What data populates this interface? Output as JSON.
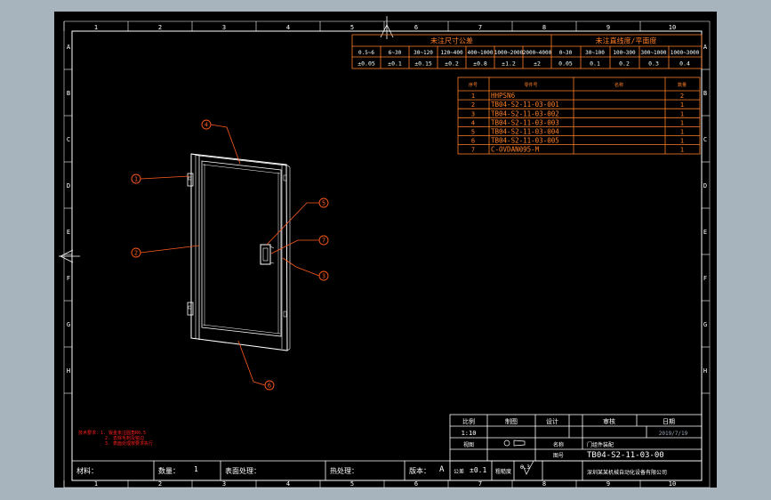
{
  "colors": {
    "background_outer": "#a7b3bd",
    "drawing_area": "#000000",
    "frame": "#ffffff",
    "table_lines": "#ff7f27",
    "leader": "#ff5a1f",
    "notes": "#ff2020"
  },
  "border_numbers_top": [
    "1",
    "2",
    "3",
    "4",
    "5",
    "6",
    "7",
    "8",
    "9",
    "10"
  ],
  "border_numbers_bottom": [
    "1",
    "2",
    "3",
    "4",
    "5",
    "6",
    "7",
    "8",
    "9",
    "10"
  ],
  "border_letters": [
    "A",
    "B",
    "C",
    "D",
    "E",
    "F",
    "G",
    "H"
  ],
  "tolerance_table": {
    "linear_title": "未注尺寸公差",
    "flatness_title": "未注直线度/平面度",
    "linear_ranges": [
      "0.5~6",
      "6~30",
      "30~120",
      "120~400",
      "400~1000",
      "1000~2000",
      "2000~4000"
    ],
    "linear_values": [
      "±0.05",
      "±0.1",
      "±0.15",
      "±0.2",
      "±0.8",
      "±1.2",
      "±2"
    ],
    "flat_ranges": [
      "0~30",
      "30~100",
      "100~300",
      "300~1000",
      "1000~3000"
    ],
    "flat_values": [
      "0.05",
      "0.1",
      "0.2",
      "0.3",
      "0.4"
    ]
  },
  "bom": {
    "headers": [
      "序号",
      "零件号",
      "名称",
      "数量"
    ],
    "rows": [
      [
        "1",
        "HHPSN6",
        "",
        "2"
      ],
      [
        "2",
        "TB04-S2-11-03-001",
        "",
        "1"
      ],
      [
        "3",
        "TB04-S2-11-03-002",
        "",
        "1"
      ],
      [
        "4",
        "TB04-S2-11-03-003",
        "",
        "1"
      ],
      [
        "5",
        "TB04-S2-11-03-004",
        "",
        "1"
      ],
      [
        "6",
        "TB04-S2-11-03-005",
        "",
        "1"
      ],
      [
        "7",
        "C-OVDAN095-M",
        "",
        "1"
      ]
    ]
  },
  "balloons": [
    "1",
    "2",
    "3",
    "4",
    "5",
    "6",
    "7"
  ],
  "notes": [
    "技术要求：1. 钣金未注圆角R0.5",
    "2. 去除毛刺及锐边",
    "3. 表面处理按要求执行"
  ],
  "title_block": {
    "scale_label": "比例",
    "scale_value": "1:10",
    "drawn_label": "制图",
    "design_label": "设计",
    "check_label": "审核",
    "date_label": "日期",
    "date_value": "2019/7/19",
    "projection_label": "视图",
    "name_label": "名称",
    "name_value": "门组件装配",
    "material_label": "材料：",
    "quantity_label": "数量：",
    "quantity_value": "1",
    "surface_label": "表面处理：",
    "heat_label": "热处理：",
    "version_label": "版本：",
    "version_value": "A",
    "tolerance_label": "公差",
    "tolerance_value": "±0.1",
    "roughness_label": "粗糙度",
    "roughness_value": "6.3",
    "drawing_no_label": "图号",
    "drawing_no_value": "TB04-S2-11-03-00",
    "company": "深圳某某机械自动化设备有限公司"
  }
}
